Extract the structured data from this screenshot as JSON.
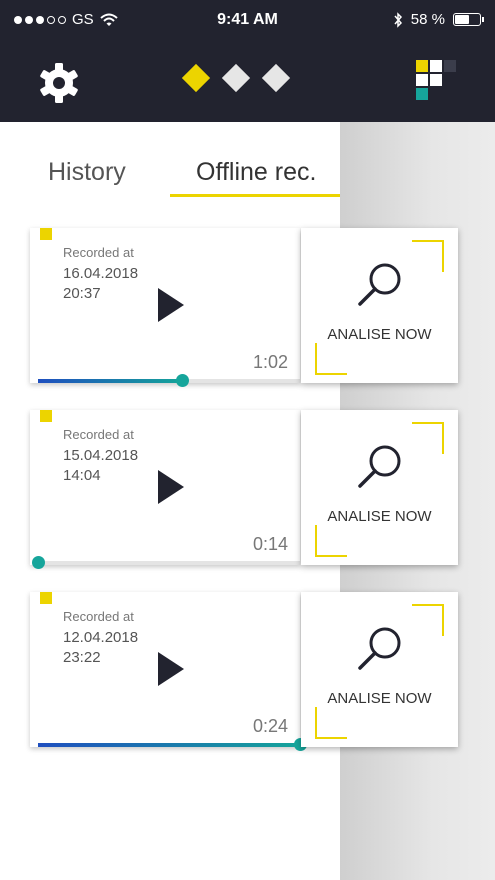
{
  "status": {
    "carrier": "GS",
    "signal": [
      true,
      true,
      true,
      false,
      false
    ],
    "time": "9:41 AM",
    "battery_text": "58 %",
    "battery_level": 0.58
  },
  "nav": {
    "pager_active": 0,
    "pager_count": 3
  },
  "tabs": {
    "history": "History",
    "offline": "Offline rec."
  },
  "recordings": [
    {
      "label": "Recorded at",
      "date": "16.04.2018",
      "time": "20:37",
      "duration": "1:02",
      "progress": 0.55,
      "action": "ANALISE NOW"
    },
    {
      "label": "Recorded at",
      "date": "15.04.2018",
      "time": "14:04",
      "duration": "0:14",
      "progress": 0.0,
      "action": "ANALISE NOW"
    },
    {
      "label": "Recorded at",
      "date": "12.04.2018",
      "time": "23:22",
      "duration": "0:24",
      "progress": 1.0,
      "action": "ANALISE NOW"
    }
  ],
  "colors": {
    "accent": "#ecd400",
    "dark": "#22232f",
    "teal": "#16a59b",
    "blue": "#1f4fbf"
  },
  "icons": {
    "settings": "gear-icon",
    "logo": "app-logo-icon",
    "play": "play-icon",
    "analyse": "magnifier-icon",
    "wifi": "wifi-icon",
    "bluetooth": "bluetooth-icon"
  }
}
